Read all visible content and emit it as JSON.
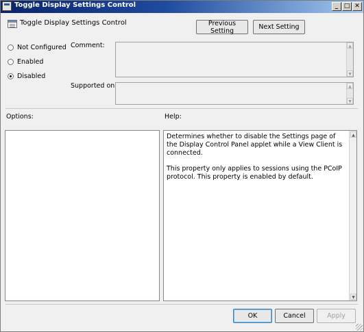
{
  "window": {
    "title": "Toggle Display Settings Control",
    "minimize_glyph": "_",
    "restore_glyph": "□",
    "close_glyph": "✕"
  },
  "header": {
    "setting_name": "Toggle Display Settings Control",
    "previous_label": "Previous Setting",
    "next_label": "Next Setting"
  },
  "state": {
    "options": [
      {
        "label": "Not Configured",
        "checked": false
      },
      {
        "label": "Enabled",
        "checked": false
      },
      {
        "label": "Disabled",
        "checked": true
      }
    ]
  },
  "fields": {
    "comment_label": "Comment:",
    "comment_value": "",
    "supported_label": "Supported on:",
    "supported_value": ""
  },
  "sections": {
    "options_label": "Options:",
    "help_label": "Help:"
  },
  "help": {
    "paragraphs": [
      "Determines whether to disable the Settings page of the Display Control Panel applet while a View Client is connected.",
      "This property only applies to sessions using the PCoIP protocol. This property is enabled by default."
    ]
  },
  "footer": {
    "ok_label": "OK",
    "cancel_label": "Cancel",
    "apply_label": "Apply"
  },
  "icons": {
    "scroll_up": "▲",
    "scroll_down": "▼"
  }
}
